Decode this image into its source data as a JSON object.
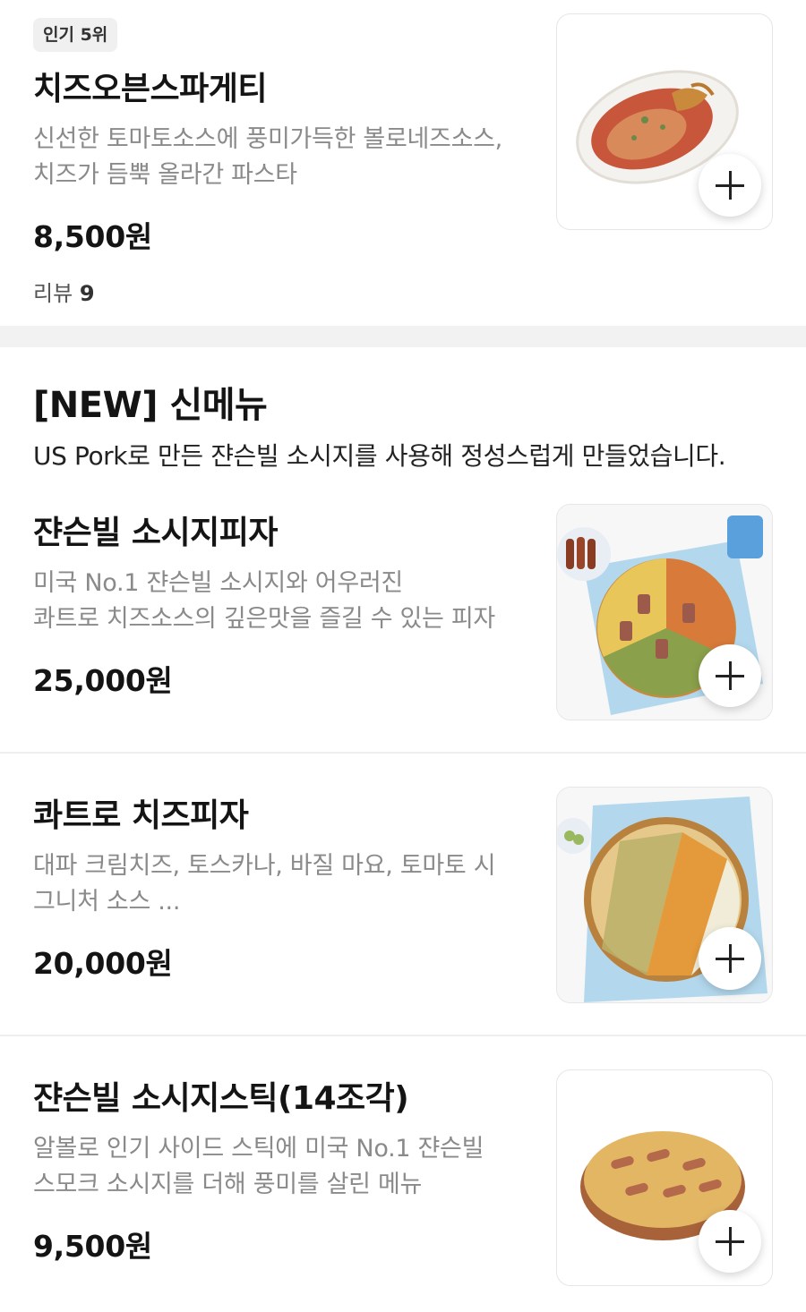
{
  "items": [
    {
      "badge": "인기 5위",
      "name": "치즈오븐스파게티",
      "desc_line1": "신선한 토마토소스에 풍미가득한 볼로네즈소스,",
      "desc_line2": "치즈가 듬뿍 올라간 파스타",
      "price": "8,500원",
      "review_label": "리뷰",
      "review_count": "9"
    },
    {
      "name": "쟌슨빌 소시지피자",
      "desc_line1": "미국 No.1 쟌슨빌 소시지와 어우러진",
      "desc_line2": "콰트로 치즈소스의 깊은맛을 즐길 수 있는 피자",
      "price": "25,000원"
    },
    {
      "name": "콰트로 치즈피자",
      "desc_line1": "대파 크림치즈, 토스카나, 바질 마요, 토마토 시",
      "desc_line2": "그니처 소스 ...",
      "price": "20,000원"
    },
    {
      "name": "쟌슨빌 소시지스틱(14조각)",
      "desc_line1": "알볼로 인기 사이드 스틱에 미국 No.1 쟌슨빌",
      "desc_line2": "스모크 소시지를 더해 풍미를 살린 메뉴",
      "price": "9,500원"
    }
  ],
  "section": {
    "title": "[NEW] 신메뉴",
    "description": "US Pork로 만든 쟌슨빌 소시지를 사용해 정성스럽게 만들었습니다."
  },
  "icons": {
    "add": "plus-icon"
  },
  "colors": {
    "background": "#ffffff",
    "divider": "#f2f2f2",
    "badge_bg": "#f0f0f0",
    "muted_text": "#8a8a8a"
  }
}
